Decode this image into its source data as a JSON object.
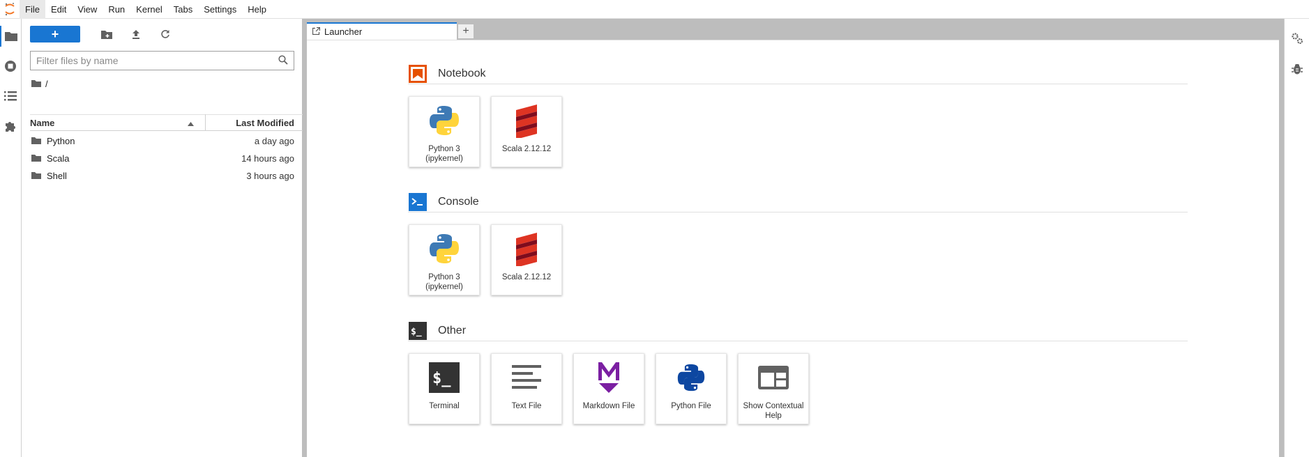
{
  "menu": [
    "File",
    "Edit",
    "View",
    "Run",
    "Kernel",
    "Tabs",
    "Settings",
    "Help"
  ],
  "file_browser": {
    "new_button_label": "+",
    "filter_placeholder": "Filter files by name",
    "breadcrumb": "/",
    "columns": {
      "name": "Name",
      "modified": "Last Modified"
    },
    "files": [
      {
        "name": "Python",
        "modified": "a day ago"
      },
      {
        "name": "Scala",
        "modified": "14 hours ago"
      },
      {
        "name": "Shell",
        "modified": "3 hours ago"
      }
    ]
  },
  "tabs": {
    "active": "Launcher",
    "add_label": "+"
  },
  "launcher": {
    "notebook": {
      "title": "Notebook",
      "cards": [
        {
          "label": "Python 3 (ipykernel)",
          "icon": "python-icon"
        },
        {
          "label": "Scala 2.12.12",
          "icon": "scala-icon"
        }
      ]
    },
    "console": {
      "title": "Console",
      "cards": [
        {
          "label": "Python 3 (ipykernel)",
          "icon": "python-icon"
        },
        {
          "label": "Scala 2.12.12",
          "icon": "scala-icon"
        }
      ]
    },
    "other": {
      "title": "Other",
      "cards": [
        {
          "label": "Terminal",
          "icon": "terminal-icon"
        },
        {
          "label": "Text File",
          "icon": "text-file-icon"
        },
        {
          "label": "Markdown File",
          "icon": "markdown-icon"
        },
        {
          "label": "Python File",
          "icon": "python-file-icon"
        },
        {
          "label": "Show Contextual Help",
          "icon": "contextual-help-icon"
        }
      ]
    }
  },
  "colors": {
    "accent": "#1976d2",
    "notebook": "#e65100",
    "scala": "#de3423",
    "markdown": "#7b1fa2"
  }
}
